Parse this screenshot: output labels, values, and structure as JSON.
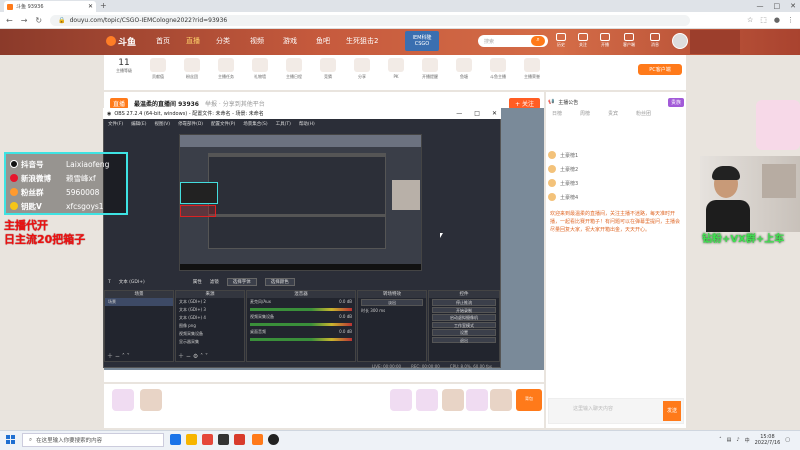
{
  "browser": {
    "tab_title": "斗鱼 93936",
    "new_tab": "+",
    "url": "douyu.com/topic/CSGO-IEMCologne2022?rid=93936",
    "window_controls": [
      "—",
      "□",
      "✕"
    ]
  },
  "site": {
    "logo": "斗鱼",
    "nav": [
      "首页",
      "直播",
      "分类",
      "视频",
      "游戏",
      "鱼吧",
      "生死狙击2",
      "IEM科隆 CSGO"
    ],
    "search_placeholder": "搜索",
    "header_icons": [
      "历史",
      "关注",
      "开播",
      "客户端",
      "消息"
    ]
  },
  "room": {
    "level": "11",
    "level_label": "主播等级",
    "stats": [
      "贡献值",
      "粉丝团",
      "主播任务",
      "礼物墙",
      "主播日程",
      "竞猜",
      "分享",
      "PK",
      "开播提醒",
      "鱼塘",
      "斗鱼主播",
      "主播荣誉"
    ],
    "pc_button": "PC客户端",
    "title_tag": "直播",
    "title": "最温柔的直播间 93936",
    "subtitle": "举报 · 分享到其他平台",
    "follow": "+ 关注"
  },
  "obs": {
    "title": "OBS 27.2.4 (64-bit, windows) - 配置文件: 未命名 - 场景: 未命名",
    "menu": [
      "文件(F)",
      "编辑(E)",
      "视图(V)",
      "停靠部件(D)",
      "配置文件(P)",
      "场景集合(S)",
      "工具(T)",
      "帮助(H)"
    ],
    "source_bar_label": "文本 (GDI+)",
    "source_buttons": [
      "属性",
      "滤镜",
      "选择字体",
      "选择颜色"
    ],
    "scene_header": "场景",
    "source_header": "来源",
    "mixer_header": "混音器",
    "trans_header": "转场特效",
    "ctrl_header": "控件",
    "scenes": [
      "场景"
    ],
    "sources": [
      "文本 (GDI+) 2",
      "文本 (GDI+) 3",
      "文本 (GDI+) 4",
      "图像 png",
      "视频采集设备",
      "显示器采集"
    ],
    "mixer": [
      {
        "name": "麦克风/Aux",
        "db": "0.0 dB"
      },
      {
        "name": "视频采集设备",
        "db": "0.0 dB"
      },
      {
        "name": "桌面音频",
        "db": "0.0 dB"
      }
    ],
    "transition": "淡出",
    "duration_label": "时长",
    "duration": "300 ms",
    "controls": [
      "停止推流",
      "开始录制",
      "启动虚拟摄像机",
      "工作室模式",
      "设置",
      "退出"
    ],
    "status": [
      "LIVE: 00:00:00",
      "REC: 00:00:00",
      "CPU: 8.0%, 60.00 fps"
    ]
  },
  "overlay": {
    "social": [
      {
        "key": "抖音号",
        "value": "Laixiaofeng",
        "icon": "tiktok-icon",
        "color": "#ffffff"
      },
      {
        "key": "新浪微博",
        "value": "赖雪峰xf",
        "icon": "weibo-icon",
        "color": "#e6162d"
      },
      {
        "key": "粉丝群",
        "value": "5960008",
        "icon": "fans-icon",
        "color": "#ff9a2e"
      },
      {
        "key": "钥匙V",
        "value": "xfcsgoys1",
        "icon": "key-icon",
        "color": "#f5c518"
      }
    ],
    "red_lines": [
      "主播代开",
      "日主流20把箱子"
    ],
    "green_text": "钻粉+VX群+上车"
  },
  "chat": {
    "header": "主播公告",
    "badge": "贵族",
    "tabs": [
      "日榜",
      "周榜",
      "贵宾",
      "粉丝团"
    ],
    "ranks": [
      "土豪榜1",
      "土豪榜2",
      "土豪榜3",
      "土豪榜4"
    ],
    "notice": "欢迎来到最温柔的直播间，关注主播不迷路，每天准时开播，一起看比赛开箱子！有问题可以在弹幕里提问，主播会尽量回复大家，祝大家开箱出金，天天开心。",
    "input_placeholder": "这里输入聊天内容",
    "send": "发送"
  },
  "gifts": {
    "send_label": "背包"
  },
  "taskbar": {
    "search": "在这里输入你要搜索的内容",
    "time": "15:08",
    "date": "2022/7/16",
    "lang": "中"
  }
}
